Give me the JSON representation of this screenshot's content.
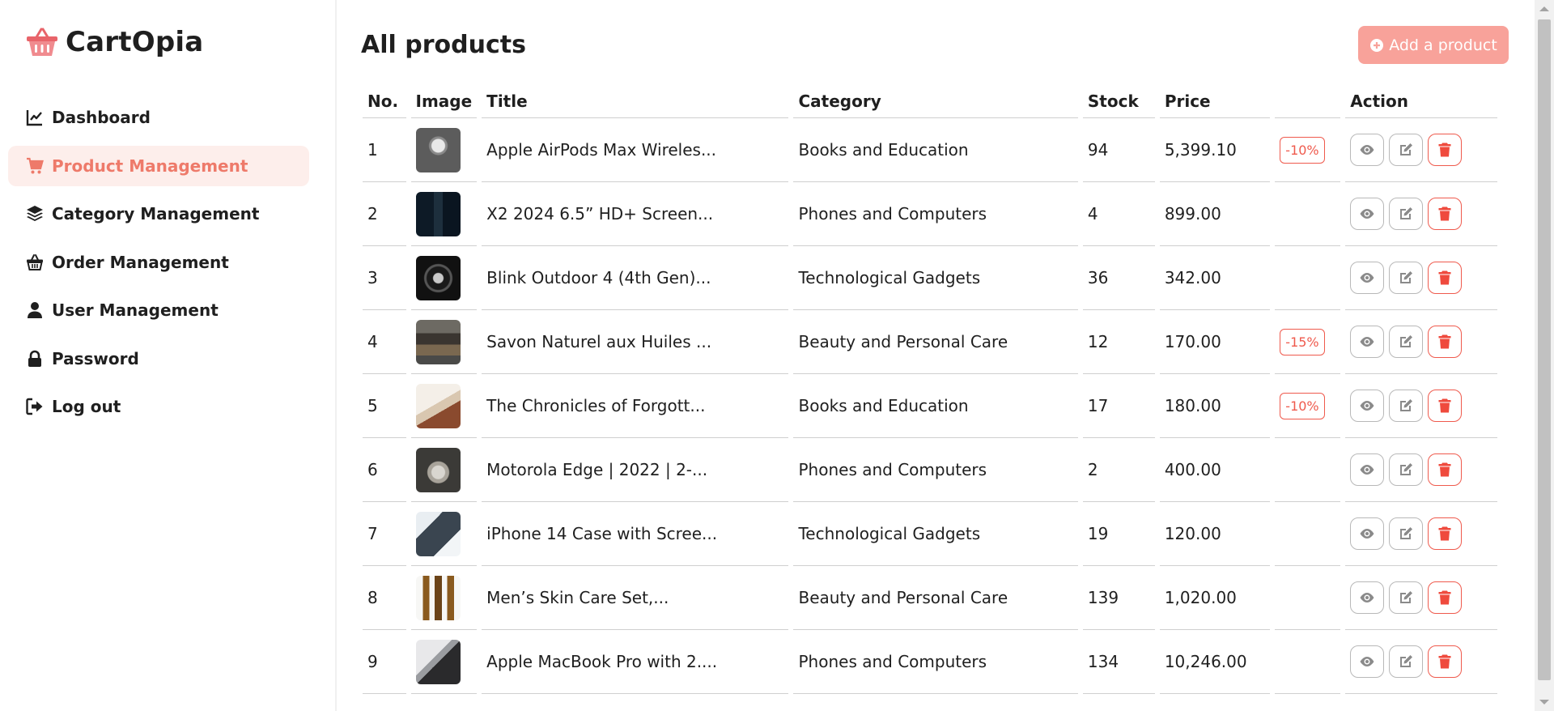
{
  "app": {
    "name": "CartOpia"
  },
  "nav": [
    {
      "label": "Dashboard",
      "icon": "chart-line-icon",
      "active": false
    },
    {
      "label": "Product Management",
      "icon": "cart-icon",
      "active": true
    },
    {
      "label": "Category Management",
      "icon": "layers-icon",
      "active": false
    },
    {
      "label": "Order Management",
      "icon": "basket-icon",
      "active": false
    },
    {
      "label": "User Management",
      "icon": "user-icon",
      "active": false
    },
    {
      "label": "Password",
      "icon": "lock-icon",
      "active": false
    },
    {
      "label": "Log out",
      "icon": "logout-icon",
      "active": false
    }
  ],
  "page": {
    "title": "All products",
    "add_button": "Add a product"
  },
  "table": {
    "headers": {
      "no": "No.",
      "image": "Image",
      "title": "Title",
      "category": "Category",
      "stock": "Stock",
      "price": "Price",
      "action": "Action"
    },
    "rows": [
      {
        "no": "1",
        "title": "Apple AirPods Max Wireles...",
        "category": "Books and Education",
        "stock": "94",
        "price": "5,399.10",
        "discount": "-10%"
      },
      {
        "no": "2",
        "title": "X2 2024 6.5” HD+ Screen...",
        "category": "Phones and Computers",
        "stock": "4",
        "price": "899.00",
        "discount": ""
      },
      {
        "no": "3",
        "title": "Blink Outdoor 4 (4th Gen)...",
        "category": "Technological Gadgets",
        "stock": "36",
        "price": "342.00",
        "discount": ""
      },
      {
        "no": "4",
        "title": "Savon Naturel aux Huiles ...",
        "category": "Beauty and Personal Care",
        "stock": "12",
        "price": "170.00",
        "discount": "-15%"
      },
      {
        "no": "5",
        "title": "The Chronicles of Forgott...",
        "category": "Books and Education",
        "stock": "17",
        "price": "180.00",
        "discount": "-10%"
      },
      {
        "no": "6",
        "title": "Motorola Edge | 2022 | 2-...",
        "category": "Phones and Computers",
        "stock": "2",
        "price": "400.00",
        "discount": ""
      },
      {
        "no": "7",
        "title": "iPhone 14 Case with Scree...",
        "category": "Technological Gadgets",
        "stock": "19",
        "price": "120.00",
        "discount": ""
      },
      {
        "no": "8",
        "title": "Men’s Skin Care Set,...",
        "category": "Beauty and Personal Care",
        "stock": "139",
        "price": "1,020.00",
        "discount": ""
      },
      {
        "no": "9",
        "title": "Apple MacBook Pro with 2....",
        "category": "Phones and Computers",
        "stock": "134",
        "price": "10,246.00",
        "discount": ""
      }
    ]
  },
  "colors": {
    "accent": "#ee7a6a",
    "active_bg": "#fdeeeb",
    "add_button_bg": "#f8a29a",
    "danger": "#ef4a3d"
  }
}
